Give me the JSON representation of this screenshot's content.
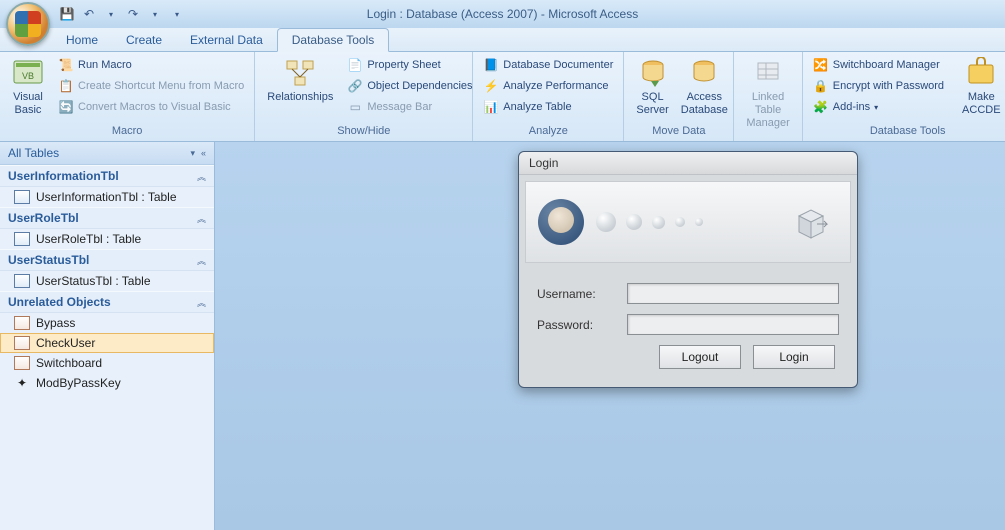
{
  "title": "Login : Database (Access 2007) - Microsoft Access",
  "tabs": {
    "home": "Home",
    "create": "Create",
    "external": "External Data",
    "dbtools": "Database Tools"
  },
  "ribbon": {
    "macro": {
      "vb": "Visual\nBasic",
      "run": "Run Macro",
      "shortcut": "Create Shortcut Menu from Macro",
      "convert": "Convert Macros to Visual Basic",
      "label": "Macro"
    },
    "showhide": {
      "rel": "Relationships",
      "prop": "Property Sheet",
      "dep": "Object Dependencies",
      "msg": "Message Bar",
      "label": "Show/Hide"
    },
    "analyze": {
      "doc": "Database Documenter",
      "perf": "Analyze Performance",
      "table": "Analyze Table",
      "label": "Analyze"
    },
    "move": {
      "sql": "SQL\nServer",
      "access": "Access\nDatabase",
      "label": "Move Data"
    },
    "linked": {
      "mgr": "Linked Table\nManager"
    },
    "dbtools": {
      "switch": "Switchboard Manager",
      "encrypt": "Encrypt with Password",
      "addins": "Add-ins",
      "label": "Database Tools"
    },
    "accde": {
      "make": "Make\nACCDE"
    }
  },
  "nav": {
    "header": "All Tables",
    "groups": [
      {
        "title": "UserInformationTbl",
        "items": [
          {
            "label": "UserInformationTbl : Table",
            "type": "table"
          }
        ]
      },
      {
        "title": "UserRoleTbl",
        "items": [
          {
            "label": "UserRoleTbl : Table",
            "type": "table"
          }
        ]
      },
      {
        "title": "UserStatusTbl",
        "items": [
          {
            "label": "UserStatusTbl : Table",
            "type": "table"
          }
        ]
      },
      {
        "title": "Unrelated Objects",
        "items": [
          {
            "label": "Bypass",
            "type": "form"
          },
          {
            "label": "CheckUser",
            "type": "form",
            "selected": true
          },
          {
            "label": "Switchboard",
            "type": "form"
          },
          {
            "label": "ModByPassKey",
            "type": "module"
          }
        ]
      }
    ]
  },
  "login": {
    "title": "Login",
    "username_label": "Username:",
    "password_label": "Password:",
    "username_value": "",
    "password_value": "",
    "logout_btn": "Logout",
    "login_btn": "Login"
  }
}
